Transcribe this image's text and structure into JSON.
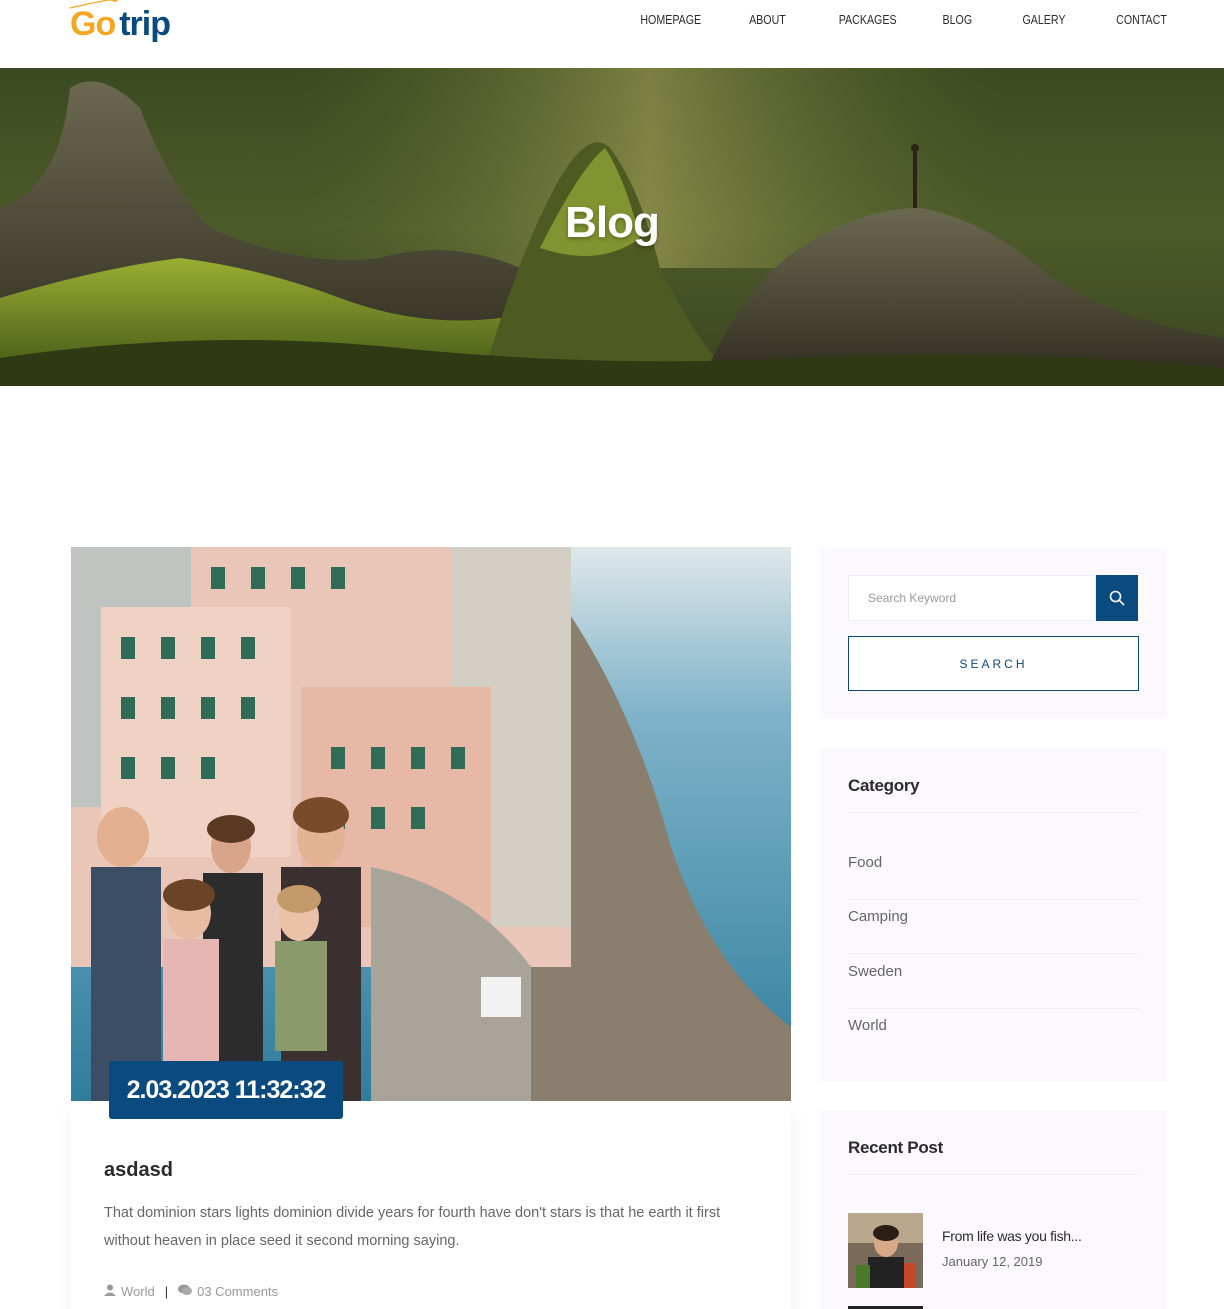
{
  "logo": {
    "part1": "Go",
    "part2": "trip"
  },
  "nav": {
    "items": [
      {
        "label": "HOMEPAGE"
      },
      {
        "label": "ABOUT"
      },
      {
        "label": "PACKAGES"
      },
      {
        "label": "BLOG"
      },
      {
        "label": "GALERY"
      },
      {
        "label": "CONTACT"
      }
    ]
  },
  "hero": {
    "title": "Blog"
  },
  "post": {
    "date": "2.03.2023 11:32:32",
    "title": "asdasd",
    "excerpt": "That dominion stars lights dominion divide years for fourth have don't stars is that he earth it first without heaven in place seed it second morning saying.",
    "category": "World",
    "comments": "03 Comments"
  },
  "sidebar": {
    "search": {
      "placeholder": "Search Keyword",
      "button_label": "SEARCH"
    },
    "category": {
      "title": "Category",
      "items": [
        {
          "label": "Food"
        },
        {
          "label": "Camping"
        },
        {
          "label": "Sweden"
        },
        {
          "label": "World"
        }
      ]
    },
    "recent": {
      "title": "Recent Post",
      "items": [
        {
          "title": "From life was you fish...",
          "date": "January 12, 2019"
        }
      ]
    }
  },
  "colors": {
    "primary": "#0a4a7f",
    "accent": "#f5a623",
    "widget_bg": "#fbf9ff"
  }
}
